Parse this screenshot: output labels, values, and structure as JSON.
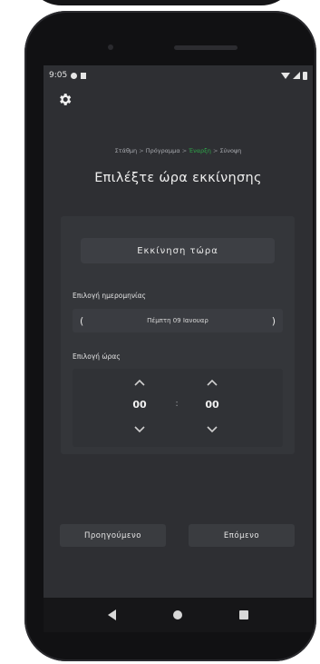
{
  "status_bar": {
    "time": "9:05"
  },
  "breadcrumb": {
    "steps": [
      "Στάθμη",
      "Πρόγραμμα",
      "Έναρξη",
      "Σύνοψη"
    ],
    "separator": ">",
    "active_index": 2
  },
  "page_title": "Επιλέξτε ώρα εκκίνησης",
  "start_now_button": "Εκκίνηση τώρα",
  "date_section": {
    "label": "Επιλογή ημερομηνίας",
    "value": "Πέμπτη 09 Ιανουαρ",
    "prev_symbol": "(",
    "next_symbol": ")"
  },
  "time_section": {
    "label": "Επιλογή ώρας",
    "hours": "00",
    "minutes": "00",
    "separator": ":"
  },
  "nav_buttons": {
    "previous": "Προηγούμενο",
    "next": "Επόμενο"
  },
  "colors": {
    "background": "#2e2f33",
    "accent_green": "#2ea84a"
  },
  "icons": {
    "settings": "gear-icon",
    "up": "chevron-up-icon",
    "down": "chevron-down-icon"
  }
}
